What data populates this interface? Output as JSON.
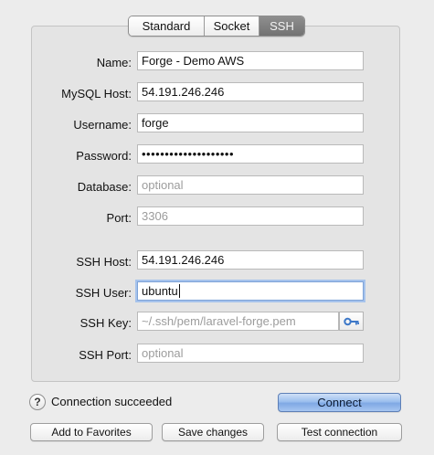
{
  "tabs": [
    {
      "label": "Standard",
      "active": false
    },
    {
      "label": "Socket",
      "active": false
    },
    {
      "label": "SSH",
      "active": true
    }
  ],
  "form": {
    "name": {
      "label": "Name:",
      "value": "Forge - Demo AWS"
    },
    "mysql_host": {
      "label": "MySQL Host:",
      "value": "54.191.246.246"
    },
    "username": {
      "label": "Username:",
      "value": "forge"
    },
    "password": {
      "label": "Password:",
      "value": "••••••••••••••••••••"
    },
    "database": {
      "label": "Database:",
      "placeholder": "optional"
    },
    "port": {
      "label": "Port:",
      "placeholder": "3306"
    },
    "ssh_host": {
      "label": "SSH Host:",
      "value": "54.191.246.246"
    },
    "ssh_user": {
      "label": "SSH User:",
      "value": "ubuntu"
    },
    "ssh_key": {
      "label": "SSH Key:",
      "value": "~/.ssh/pem/laravel-forge.pem"
    },
    "ssh_port": {
      "label": "SSH Port:",
      "placeholder": "optional"
    }
  },
  "status": {
    "help_label": "?",
    "text": "Connection succeeded"
  },
  "buttons": {
    "connect": "Connect",
    "add_favorites": "Add to Favorites",
    "save_changes": "Save changes",
    "test_connection": "Test connection"
  },
  "icons": {
    "key": "key-icon"
  },
  "colors": {
    "window_bg": "#ececec",
    "panel_bg": "#e4e4e4",
    "primary_button": "#7fa8e4",
    "focus_ring": "#a6c3ec",
    "key_icon": "#3d78c8"
  }
}
